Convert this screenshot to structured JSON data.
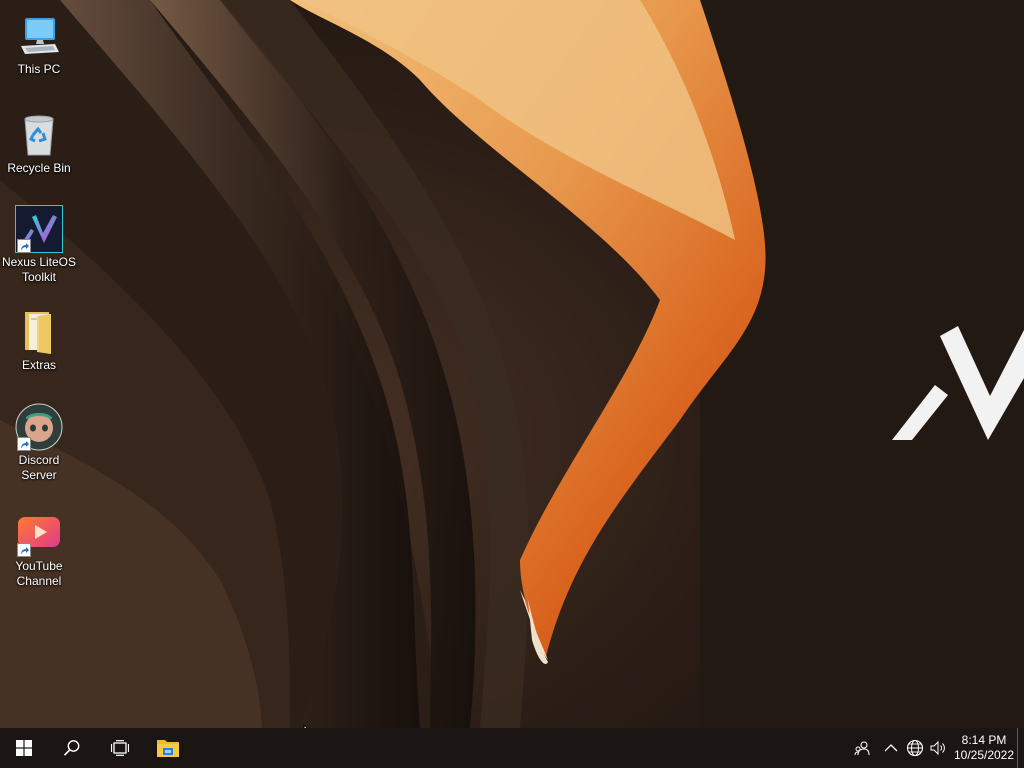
{
  "desktop": {
    "icons": [
      {
        "label": "This PC",
        "icon": "computer-icon",
        "shortcut": false
      },
      {
        "label": "Recycle Bin",
        "icon": "recycle-bin-icon",
        "shortcut": false
      },
      {
        "label": "Nexus LiteOS Toolkit",
        "icon": "nexus-logo-icon",
        "shortcut": true
      },
      {
        "label": "Extras",
        "icon": "folder-icon",
        "shortcut": false
      },
      {
        "label": "Discord Server",
        "icon": "discord-icon",
        "shortcut": true
      },
      {
        "label": "YouTube Channel",
        "icon": "youtube-icon",
        "shortcut": true
      }
    ]
  },
  "taskbar": {
    "start": "windows-logo-icon",
    "search": "search-icon",
    "task_view": "task-view-icon",
    "pinned": [
      "file-explorer-icon"
    ],
    "tray": [
      "people-icon",
      "chevron-up-icon",
      "globe-network-icon",
      "speaker-icon"
    ],
    "clock": {
      "time": "8:14 PM",
      "date": "10/25/2022"
    }
  },
  "colors": {
    "taskbar_bg": "#1b1614",
    "wallpaper_dark": "#1e140f",
    "wallpaper_orange": "#e0782a",
    "accent_blue": "#0078d7"
  }
}
